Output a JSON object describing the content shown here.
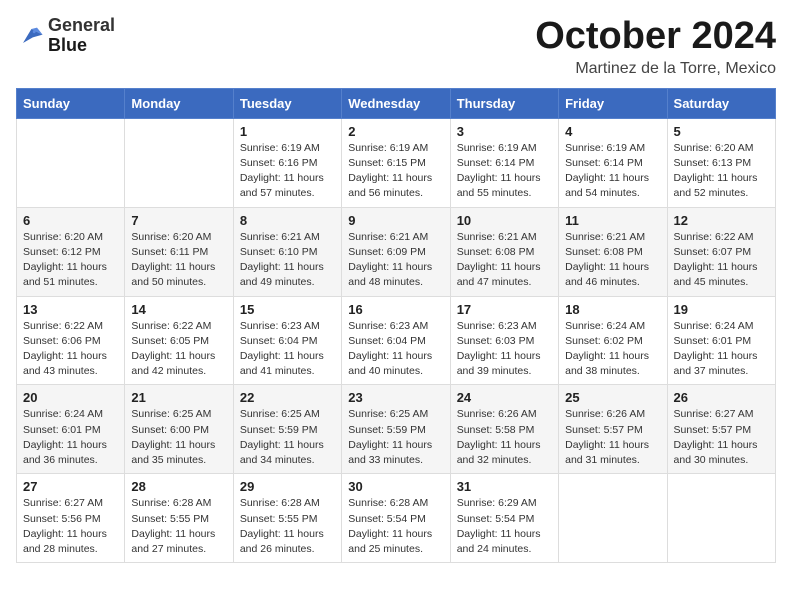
{
  "header": {
    "logo_line1": "General",
    "logo_line2": "Blue",
    "month": "October 2024",
    "location": "Martinez de la Torre, Mexico"
  },
  "days_of_week": [
    "Sunday",
    "Monday",
    "Tuesday",
    "Wednesday",
    "Thursday",
    "Friday",
    "Saturday"
  ],
  "weeks": [
    [
      {
        "day": "",
        "info": ""
      },
      {
        "day": "",
        "info": ""
      },
      {
        "day": "1",
        "info": "Sunrise: 6:19 AM\nSunset: 6:16 PM\nDaylight: 11 hours and 57 minutes."
      },
      {
        "day": "2",
        "info": "Sunrise: 6:19 AM\nSunset: 6:15 PM\nDaylight: 11 hours and 56 minutes."
      },
      {
        "day": "3",
        "info": "Sunrise: 6:19 AM\nSunset: 6:14 PM\nDaylight: 11 hours and 55 minutes."
      },
      {
        "day": "4",
        "info": "Sunrise: 6:19 AM\nSunset: 6:14 PM\nDaylight: 11 hours and 54 minutes."
      },
      {
        "day": "5",
        "info": "Sunrise: 6:20 AM\nSunset: 6:13 PM\nDaylight: 11 hours and 52 minutes."
      }
    ],
    [
      {
        "day": "6",
        "info": "Sunrise: 6:20 AM\nSunset: 6:12 PM\nDaylight: 11 hours and 51 minutes."
      },
      {
        "day": "7",
        "info": "Sunrise: 6:20 AM\nSunset: 6:11 PM\nDaylight: 11 hours and 50 minutes."
      },
      {
        "day": "8",
        "info": "Sunrise: 6:21 AM\nSunset: 6:10 PM\nDaylight: 11 hours and 49 minutes."
      },
      {
        "day": "9",
        "info": "Sunrise: 6:21 AM\nSunset: 6:09 PM\nDaylight: 11 hours and 48 minutes."
      },
      {
        "day": "10",
        "info": "Sunrise: 6:21 AM\nSunset: 6:08 PM\nDaylight: 11 hours and 47 minutes."
      },
      {
        "day": "11",
        "info": "Sunrise: 6:21 AM\nSunset: 6:08 PM\nDaylight: 11 hours and 46 minutes."
      },
      {
        "day": "12",
        "info": "Sunrise: 6:22 AM\nSunset: 6:07 PM\nDaylight: 11 hours and 45 minutes."
      }
    ],
    [
      {
        "day": "13",
        "info": "Sunrise: 6:22 AM\nSunset: 6:06 PM\nDaylight: 11 hours and 43 minutes."
      },
      {
        "day": "14",
        "info": "Sunrise: 6:22 AM\nSunset: 6:05 PM\nDaylight: 11 hours and 42 minutes."
      },
      {
        "day": "15",
        "info": "Sunrise: 6:23 AM\nSunset: 6:04 PM\nDaylight: 11 hours and 41 minutes."
      },
      {
        "day": "16",
        "info": "Sunrise: 6:23 AM\nSunset: 6:04 PM\nDaylight: 11 hours and 40 minutes."
      },
      {
        "day": "17",
        "info": "Sunrise: 6:23 AM\nSunset: 6:03 PM\nDaylight: 11 hours and 39 minutes."
      },
      {
        "day": "18",
        "info": "Sunrise: 6:24 AM\nSunset: 6:02 PM\nDaylight: 11 hours and 38 minutes."
      },
      {
        "day": "19",
        "info": "Sunrise: 6:24 AM\nSunset: 6:01 PM\nDaylight: 11 hours and 37 minutes."
      }
    ],
    [
      {
        "day": "20",
        "info": "Sunrise: 6:24 AM\nSunset: 6:01 PM\nDaylight: 11 hours and 36 minutes."
      },
      {
        "day": "21",
        "info": "Sunrise: 6:25 AM\nSunset: 6:00 PM\nDaylight: 11 hours and 35 minutes."
      },
      {
        "day": "22",
        "info": "Sunrise: 6:25 AM\nSunset: 5:59 PM\nDaylight: 11 hours and 34 minutes."
      },
      {
        "day": "23",
        "info": "Sunrise: 6:25 AM\nSunset: 5:59 PM\nDaylight: 11 hours and 33 minutes."
      },
      {
        "day": "24",
        "info": "Sunrise: 6:26 AM\nSunset: 5:58 PM\nDaylight: 11 hours and 32 minutes."
      },
      {
        "day": "25",
        "info": "Sunrise: 6:26 AM\nSunset: 5:57 PM\nDaylight: 11 hours and 31 minutes."
      },
      {
        "day": "26",
        "info": "Sunrise: 6:27 AM\nSunset: 5:57 PM\nDaylight: 11 hours and 30 minutes."
      }
    ],
    [
      {
        "day": "27",
        "info": "Sunrise: 6:27 AM\nSunset: 5:56 PM\nDaylight: 11 hours and 28 minutes."
      },
      {
        "day": "28",
        "info": "Sunrise: 6:28 AM\nSunset: 5:55 PM\nDaylight: 11 hours and 27 minutes."
      },
      {
        "day": "29",
        "info": "Sunrise: 6:28 AM\nSunset: 5:55 PM\nDaylight: 11 hours and 26 minutes."
      },
      {
        "day": "30",
        "info": "Sunrise: 6:28 AM\nSunset: 5:54 PM\nDaylight: 11 hours and 25 minutes."
      },
      {
        "day": "31",
        "info": "Sunrise: 6:29 AM\nSunset: 5:54 PM\nDaylight: 11 hours and 24 minutes."
      },
      {
        "day": "",
        "info": ""
      },
      {
        "day": "",
        "info": ""
      }
    ]
  ]
}
